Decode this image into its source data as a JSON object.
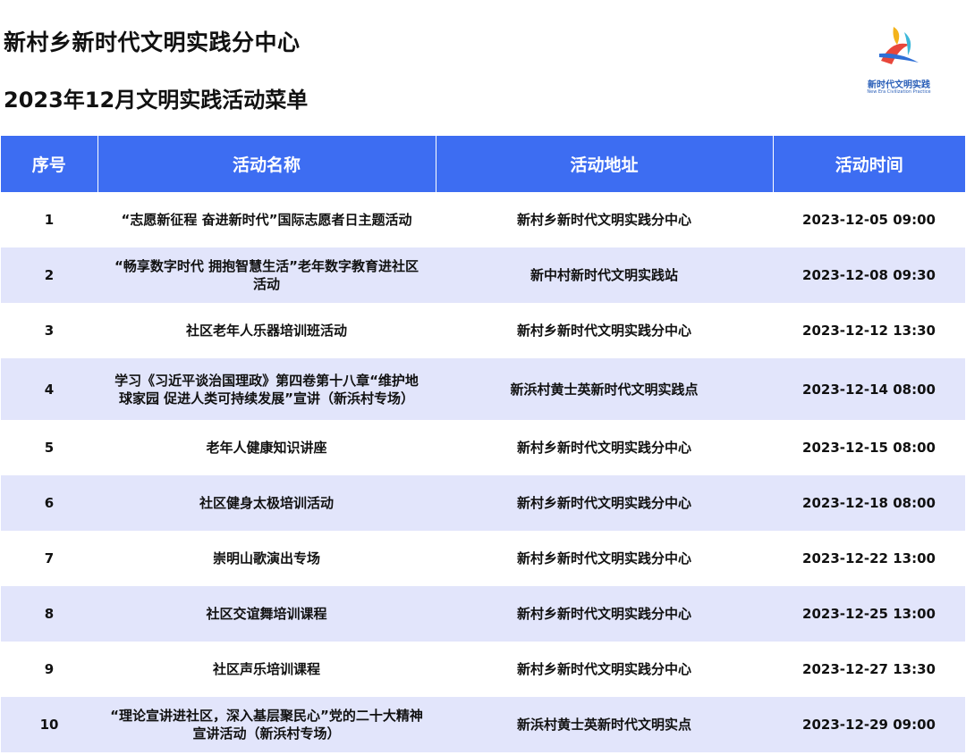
{
  "header": {
    "title": "新村乡新时代文明实践分中心",
    "subtitle": "2023年12月文明实践活动菜单"
  },
  "logo": {
    "text_cn": "新时代文明实践",
    "text_en": "New Era Civilization Practice",
    "colors": [
      "#f3b31b",
      "#e8473b",
      "#2f6fd6",
      "#3cb7d9"
    ]
  },
  "table": {
    "header_color": "#3d6df2",
    "stripe_color": "#e2e5fb",
    "columns": [
      "序号",
      "活动名称",
      "活动地址",
      "活动时间"
    ],
    "rows": [
      {
        "no": "1",
        "name": "“志愿新征程 奋进新时代”国际志愿者日主题活动",
        "place": "新村乡新时代文明实践分中心",
        "time": "2023-12-05 09:00"
      },
      {
        "no": "2",
        "name": "“畅享数字时代 拥抱智慧生活”老年数字教育进社区活动",
        "place": "新中村新时代文明实践站",
        "time": "2023-12-08 09:30"
      },
      {
        "no": "3",
        "name": "社区老年人乐器培训班活动",
        "place": "新村乡新时代文明实践分中心",
        "time": "2023-12-12 13:30"
      },
      {
        "no": "4",
        "name": "学习《习近平谈治国理政》第四卷第十八章“维护地球家园 促进人类可持续发展”宣讲（新浜村专场）",
        "place": "新浜村黄士英新时代文明实践点",
        "time": "2023-12-14 08:00"
      },
      {
        "no": "5",
        "name": "老年人健康知识讲座",
        "place": "新村乡新时代文明实践分中心",
        "time": "2023-12-15 08:00"
      },
      {
        "no": "6",
        "name": "社区健身太极培训活动",
        "place": "新村乡新时代文明实践分中心",
        "time": "2023-12-18 08:00"
      },
      {
        "no": "7",
        "name": "崇明山歌演出专场",
        "place": "新村乡新时代文明实践分中心",
        "time": "2023-12-22 13:00"
      },
      {
        "no": "8",
        "name": "社区交谊舞培训课程",
        "place": "新村乡新时代文明实践分中心",
        "time": "2023-12-25 13:00"
      },
      {
        "no": "9",
        "name": "社区声乐培训课程",
        "place": "新村乡新时代文明实践分中心",
        "time": "2023-12-27 13:30"
      },
      {
        "no": "10",
        "name": "“理论宣讲进社区，深入基层聚民心”党的二十大精神宣讲活动（新浜村专场）",
        "place": "新浜村黄士英新时代文明实点",
        "time": "2023-12-29 09:00"
      }
    ]
  }
}
